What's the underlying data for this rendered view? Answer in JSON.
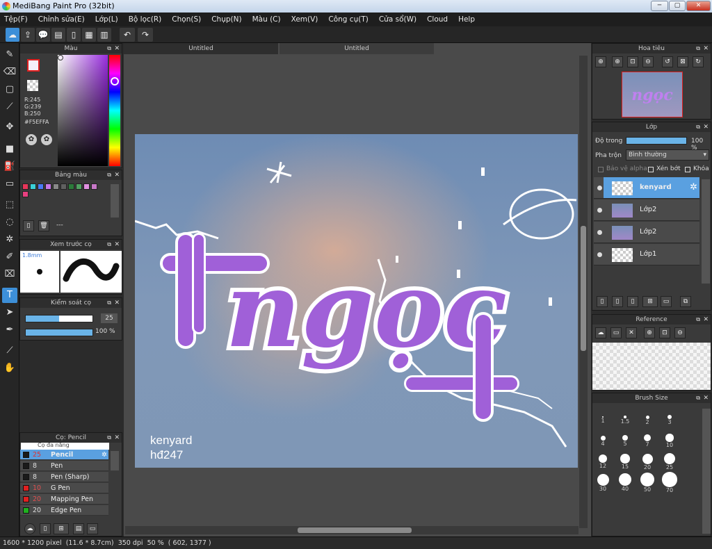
{
  "window": {
    "title": "MediBang Paint Pro (32bit)",
    "min": "─",
    "max": "▢",
    "close": "✕"
  },
  "menu": [
    "Tệp(F)",
    "Chỉnh sửa(E)",
    "Lớp(L)",
    "Bộ lọc(R)",
    "Chọn(S)",
    "Chụp(N)",
    "Màu (C)",
    "Xem(V)",
    "Công cụ(T)",
    "Cửa sổ(W)",
    "Cloud",
    "Help"
  ],
  "color_panel": {
    "title": "Màu",
    "r": "R:245",
    "g": "G:239",
    "b": "B:250",
    "hex": "#F5EFFA"
  },
  "palette_panel": {
    "title": "Bảng màu",
    "none": "---",
    "colors": [
      "#e8365a",
      "#3ad0d8",
      "#4a7af5",
      "#c878e8",
      "#888888",
      "#606060",
      "#2c7a3a",
      "#50a060",
      "#e090e0",
      "#c878c8",
      "#e84080"
    ]
  },
  "brush_preview": {
    "title": "Xem trước cọ",
    "size": "1.8mm"
  },
  "brush_control": {
    "title": "Kiểm soát cọ",
    "size": "25",
    "opacity": "100 %",
    "size_fill": 0.5,
    "opacity_fill": 1.0
  },
  "brush_panel": {
    "title": "Cọ: Pencil",
    "partial": "Cọ đa năng",
    "items": [
      {
        "size": "25",
        "name": "Pencil",
        "color": "#1a1a1a",
        "sel": true
      },
      {
        "size": "8",
        "name": "Pen",
        "color": "#1a1a1a"
      },
      {
        "size": "8",
        "name": "Pen (Sharp)",
        "color": "#1a1a1a"
      },
      {
        "size": "10",
        "name": "G Pen",
        "color": "#e02020"
      },
      {
        "size": "20",
        "name": "Mapping Pen",
        "color": "#e02020"
      },
      {
        "size": "20",
        "name": "Edge Pen",
        "color": "#20b020"
      }
    ]
  },
  "tabs": [
    "Untitled",
    "Untitled"
  ],
  "artwork": {
    "title": "ngọc",
    "watermark1": "kenyard",
    "watermark2": "hđ247"
  },
  "navigator": {
    "title": "Hoa tiêu",
    "thumb_text": "ngọc"
  },
  "layer_panel": {
    "title": "Lớp",
    "opacity_label": "Độ trong",
    "opacity_value": "100 %",
    "opacity_fill": 1.0,
    "blend_label": "Pha trộn",
    "blend_value": "Bình thường",
    "protect_alpha": "Bảo vệ alpha",
    "clipping": "Xén bớt",
    "lock": "Khóa",
    "layers": [
      {
        "name": "kenyard",
        "sel": true
      },
      {
        "name": "Lớp2"
      },
      {
        "name": "Lớp2"
      },
      {
        "name": "Lớp1"
      }
    ]
  },
  "reference_panel": {
    "title": "Reference"
  },
  "brush_size_panel": {
    "title": "Brush Size",
    "sizes": [
      "1",
      "1.5",
      "2",
      "3",
      "4",
      "5",
      "7",
      "10",
      "12",
      "15",
      "20",
      "25",
      "30",
      "40",
      "50",
      "70"
    ]
  },
  "status": {
    "dims": "1600 * 1200 pixel",
    "cm": "(11.6 * 8.7cm)",
    "dpi": "350 dpi",
    "zoom": "50 %",
    "coords": "( 602, 1377 )"
  }
}
